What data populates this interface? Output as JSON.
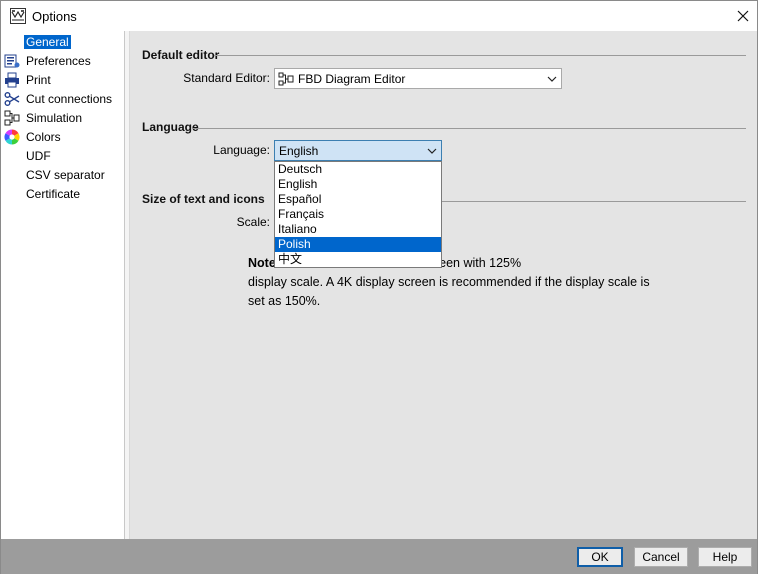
{
  "window": {
    "title": "Options"
  },
  "sidebar": {
    "items": [
      {
        "label": "General",
        "icon": "none",
        "selected": true
      },
      {
        "label": "Preferences",
        "icon": "preferences-icon"
      },
      {
        "label": "Print",
        "icon": "printer-icon"
      },
      {
        "label": "Cut connections",
        "icon": "scissors-icon"
      },
      {
        "label": "Simulation",
        "icon": "simulation-icon"
      },
      {
        "label": "Colors",
        "icon": "color-wheel-icon"
      },
      {
        "label": "UDF",
        "icon": "none"
      },
      {
        "label": "CSV separator",
        "icon": "none"
      },
      {
        "label": "Certificate",
        "icon": "none"
      }
    ]
  },
  "main": {
    "default_editor": {
      "section_title": "Default editor",
      "label": "Standard Editor:",
      "value": "FBD Diagram Editor",
      "value_icon": "fbd-diagram-icon"
    },
    "language": {
      "section_title": "Language",
      "label": "Language:",
      "value": "English",
      "options": [
        "Deutsch",
        "English",
        "Español",
        "Français",
        "Italiano",
        "Polish",
        "中文"
      ],
      "highlighted": "Polish"
    },
    "size": {
      "section_title": "Size of text and icons",
      "scale_label": "Scale:",
      "note_bold": "Note",
      "note_line1_tail": "20 * 1080 resolution screen with 125%",
      "note_line2": "display scale. A 4K display screen is recommended if the display scale is",
      "note_line3": "set as 150%."
    }
  },
  "footer": {
    "ok": "OK",
    "cancel": "Cancel",
    "help": "Help"
  },
  "colors": {
    "selection_blue": "#0066cc",
    "panel_gray": "#e4e4e4",
    "footer_gray": "#9c9c9c"
  }
}
